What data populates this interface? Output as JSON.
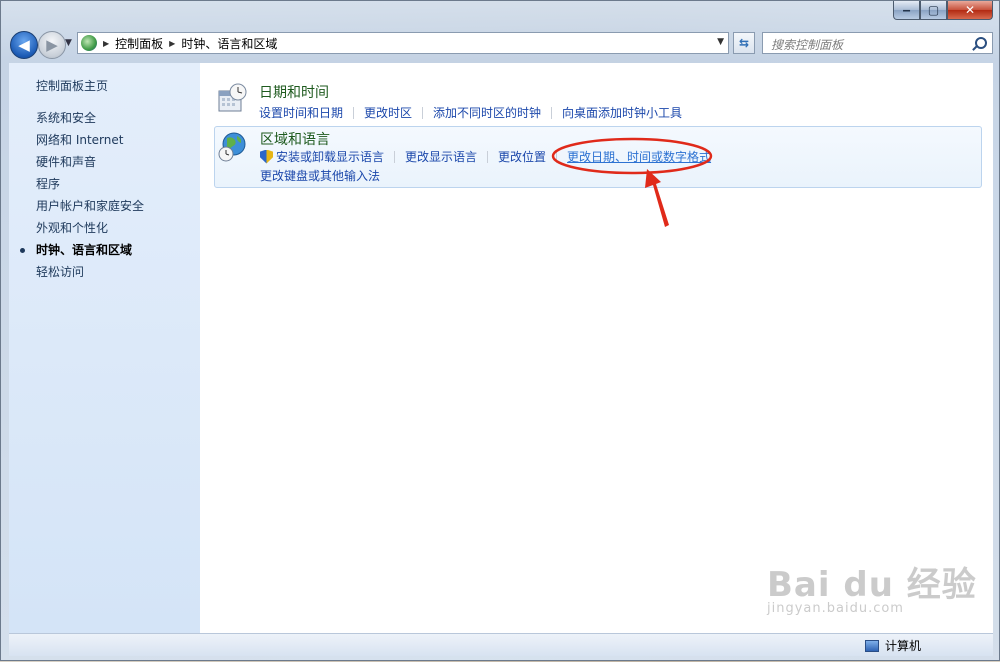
{
  "window": {
    "caption": {
      "minimize": "‒",
      "maximize": "▢",
      "close": "✕"
    }
  },
  "navbar": {
    "back": "◀",
    "forward": "▶",
    "breadcrumbs": [
      "控制面板",
      "时钟、语言和区域"
    ],
    "search_placeholder": "搜索控制面板"
  },
  "sidebar": {
    "home": "控制面板主页",
    "items": [
      {
        "label": "系统和安全"
      },
      {
        "label": "网络和 Internet"
      },
      {
        "label": "硬件和声音"
      },
      {
        "label": "程序"
      },
      {
        "label": "用户帐户和家庭安全"
      },
      {
        "label": "外观和个性化"
      },
      {
        "label": "时钟、语言和区域",
        "current": true
      },
      {
        "label": "轻松访问"
      }
    ]
  },
  "sections": [
    {
      "title": "日期和时间",
      "icon": "calendar-clock-icon",
      "links": [
        "设置时间和日期",
        "更改时区",
        "添加不同时区的时钟",
        "向桌面添加时钟小工具"
      ]
    },
    {
      "title": "区域和语言",
      "icon": "globe-clock-icon",
      "links_row1": [
        "安装或卸载显示语言",
        "更改显示语言",
        "更改位置",
        "更改日期、时间或数字格式"
      ],
      "links_row2": [
        "更改键盘或其他输入法"
      ]
    }
  ],
  "status": {
    "computer": "计算机"
  },
  "watermark": {
    "brand": "Bai du 经验",
    "url": "jingyan.baidu.com"
  },
  "colors": {
    "annotation": "#e02a1a",
    "link": "#1c48ab",
    "section_title": "#1e5a1e"
  }
}
